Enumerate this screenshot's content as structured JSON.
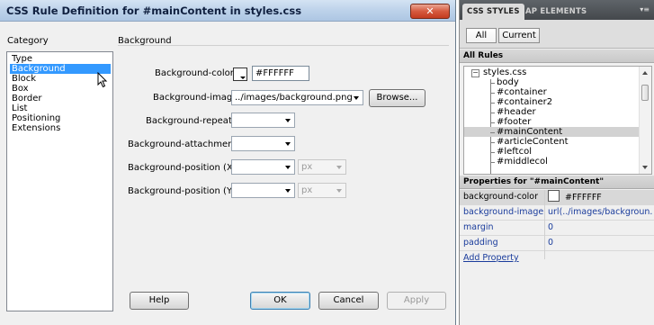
{
  "dialog": {
    "title": "CSS Rule Definition for #mainContent in styles.css",
    "close_label": "✕",
    "category_label": "Category",
    "section_label": "Background",
    "categories": [
      "Type",
      "Background",
      "Block",
      "Box",
      "Border",
      "List",
      "Positioning",
      "Extensions"
    ],
    "selected_category": "Background",
    "fields": {
      "bg_color_label": "Background-color:",
      "bg_color_value": "#FFFFFF",
      "bg_image_label": "Background-image:",
      "bg_image_value": "../images/background.png",
      "browse_label": "Browse...",
      "bg_repeat_label": "Background-repeat:",
      "bg_attachment_label": "Background-attachment:",
      "bg_pos_x_label": "Background-position (X):",
      "bg_pos_y_label": "Background-position (Y):",
      "unit_x": "px",
      "unit_y": "px"
    },
    "buttons": {
      "help": "Help",
      "ok": "OK",
      "cancel": "Cancel",
      "apply": "Apply"
    }
  },
  "panel": {
    "tabs": [
      "CSS STYLES",
      "AP ELEMENTS"
    ],
    "active_tab": "CSS STYLES",
    "menu_icon": "▾≡",
    "toggle": [
      "All",
      "Current"
    ],
    "all_rules_header": "All Rules",
    "tree_root": "styles.css",
    "tree_expander": "−",
    "rules": [
      "body",
      "#container",
      "#container2",
      "#header",
      "#footer",
      "#mainContent",
      "#articleContent",
      "#leftcol",
      "#middlecol"
    ],
    "selected_rule": "#mainContent",
    "props_header": "Properties for \"#mainContent\"",
    "properties": [
      {
        "name": "background-color",
        "value": "#FFFFFF"
      },
      {
        "name": "background-image",
        "value": "url(../images/backgroun..."
      },
      {
        "name": "margin",
        "value": "0"
      },
      {
        "name": "padding",
        "value": "0"
      }
    ],
    "add_property": "Add Property"
  }
}
